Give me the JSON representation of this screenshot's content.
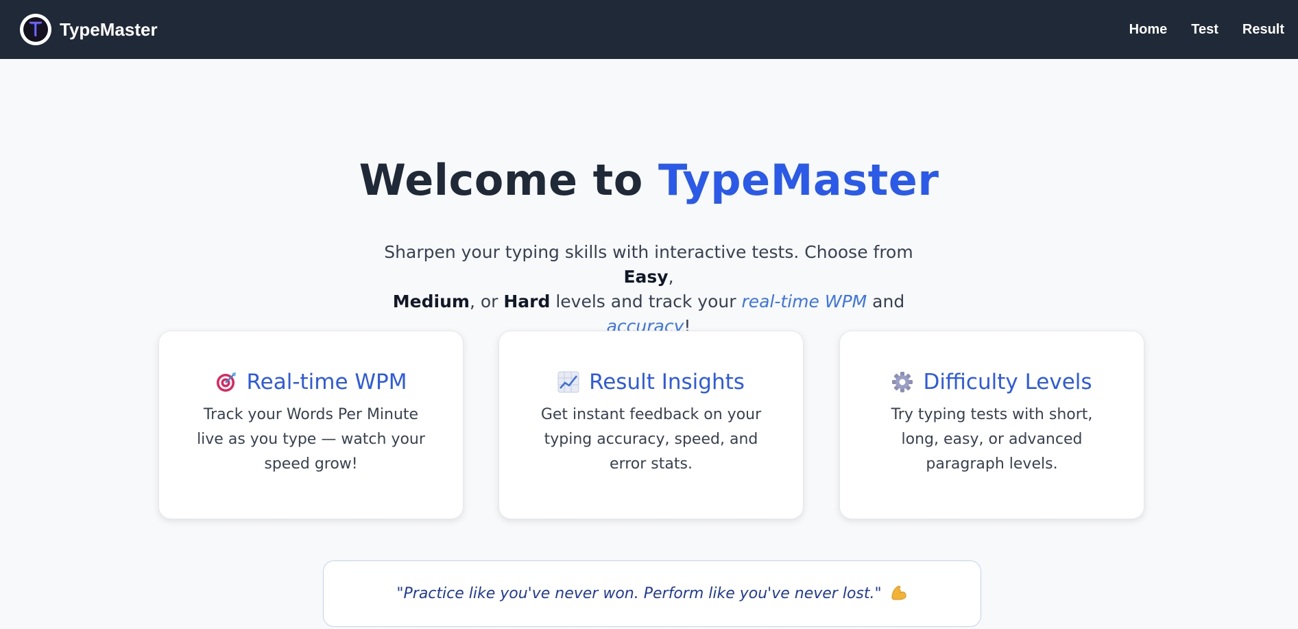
{
  "brand": {
    "name": "TypeMaster"
  },
  "nav": {
    "items": [
      "Home",
      "Test",
      "Result"
    ]
  },
  "hero": {
    "title_prefix": "Welcome to ",
    "title_accent": "TypeMaster",
    "subtitle": {
      "part1": "Sharpen your typing skills with interactive tests. Choose from ",
      "easy": "Easy",
      "comma": ",",
      "medium": "Medium",
      "or": ", or ",
      "hard": "Hard",
      "part2": " levels and track your ",
      "wpm": "real-time WPM",
      "and": " and ",
      "accuracy": "accuracy",
      "excl": "!"
    }
  },
  "cards": [
    {
      "icon": "target-icon",
      "title": "Real-time WPM",
      "text": "Track your Words Per Minute live as you type — watch your speed grow!"
    },
    {
      "icon": "chart-increasing-icon",
      "title": "Result Insights",
      "text": "Get instant feedback on your typing accuracy, speed, and error stats."
    },
    {
      "icon": "gear-icon",
      "title": "Difficulty Levels",
      "text": "Try typing tests with short, long, easy, or advanced paragraph levels."
    }
  ],
  "quote": {
    "text": "\"Practice like you've never won. Perform like you've never lost.\"",
    "icon": "flexed-bicep-icon"
  },
  "colors": {
    "navbar": "#1f2937",
    "accent": "#2b59e8",
    "background": "#f8f9fb",
    "quote_text": "#1e3a9e"
  }
}
